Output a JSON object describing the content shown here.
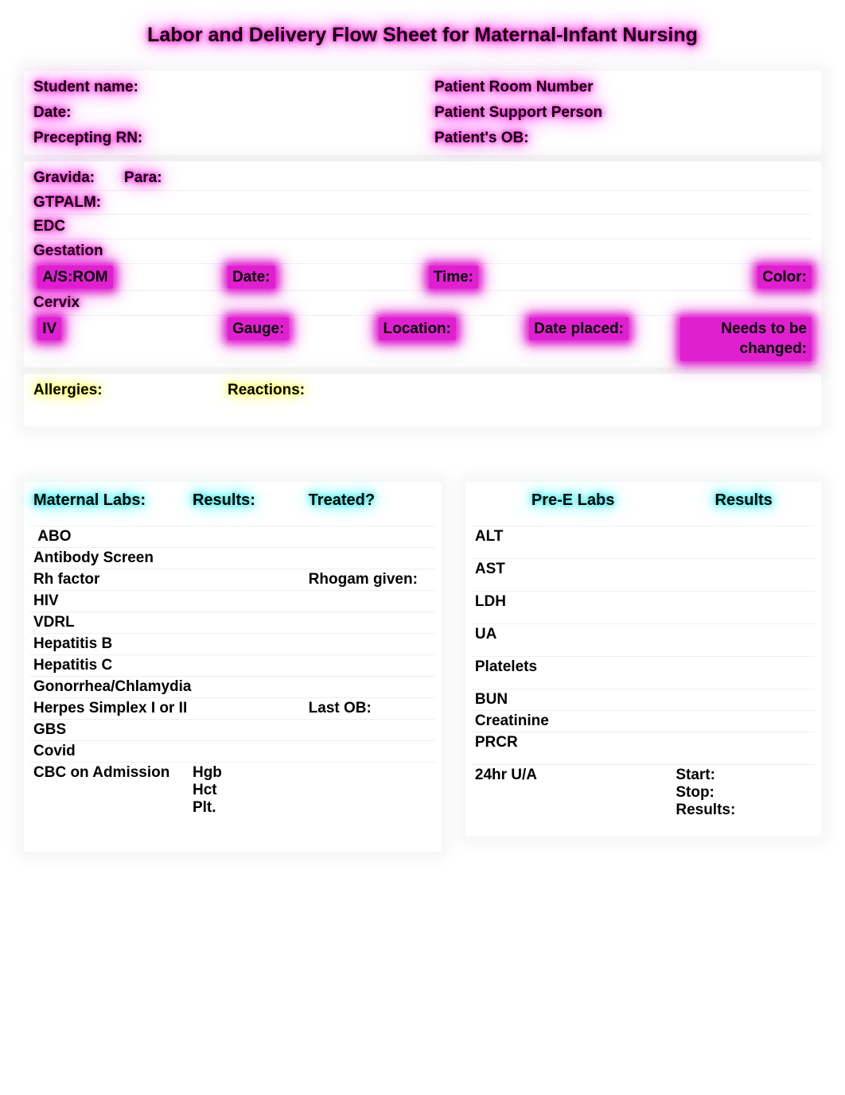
{
  "title": "Labor and Delivery Flow Sheet for Maternal-Infant Nursing",
  "hdr": {
    "student": "Student name:",
    "room": "Patient Room Number",
    "date": "Date:",
    "support": "Patient Support Person",
    "preceptor": "Precepting RN:",
    "ob": "Patient's OB:"
  },
  "ob": {
    "gravida": "Gravida:",
    "para": "Para:",
    "gtpalm": "GTPALM:",
    "edc": "EDC",
    "gestation": "Gestation",
    "asrom": "A/S:ROM",
    "asrom_date": "Date:",
    "asrom_time": "Time:",
    "asrom_color": "Color:",
    "cervix": "Cervix",
    "iv": "IV",
    "iv_gauge": "Gauge:",
    "iv_location": "Location:",
    "iv_placed": "Date placed:",
    "iv_change": "Needs to be changed:"
  },
  "alr": {
    "allergies": "Allergies:",
    "reactions": "Reactions:"
  },
  "maternal": {
    "h1": "Maternal Labs:",
    "h2": "Results:",
    "h3": "Treated?",
    "rows": {
      "abo": "ABO",
      "antibody": "Antibody Screen",
      "rh": "Rh factor",
      "rh_treated": "Rhogam given:",
      "hiv": "HIV",
      "vdrl": "VDRL",
      "hepb": "Hepatitis B",
      "hepc": "Hepatitis C",
      "gc": "Gonorrhea/Chlamydia",
      "hsv": "Herpes Simplex I or II",
      "hsv_treated": "Last OB:",
      "gbs": "GBS",
      "covid": "Covid",
      "cbc": "CBC on Admission",
      "cbc_hgb": "Hgb",
      "cbc_hct": "Hct",
      "cbc_plt": "Plt."
    }
  },
  "pree": {
    "h1": "Pre-E Labs",
    "h2": "Results",
    "rows": {
      "alt": "ALT",
      "ast": "AST",
      "ldh": "LDH",
      "ua": "UA",
      "platelets": "Platelets",
      "bun": "BUN",
      "creatinine": "Creatinine",
      "prcr": "PRCR",
      "u24": "24hr U/A",
      "u24_start": "Start:",
      "u24_stop": "Stop:",
      "u24_results": "Results:"
    }
  }
}
